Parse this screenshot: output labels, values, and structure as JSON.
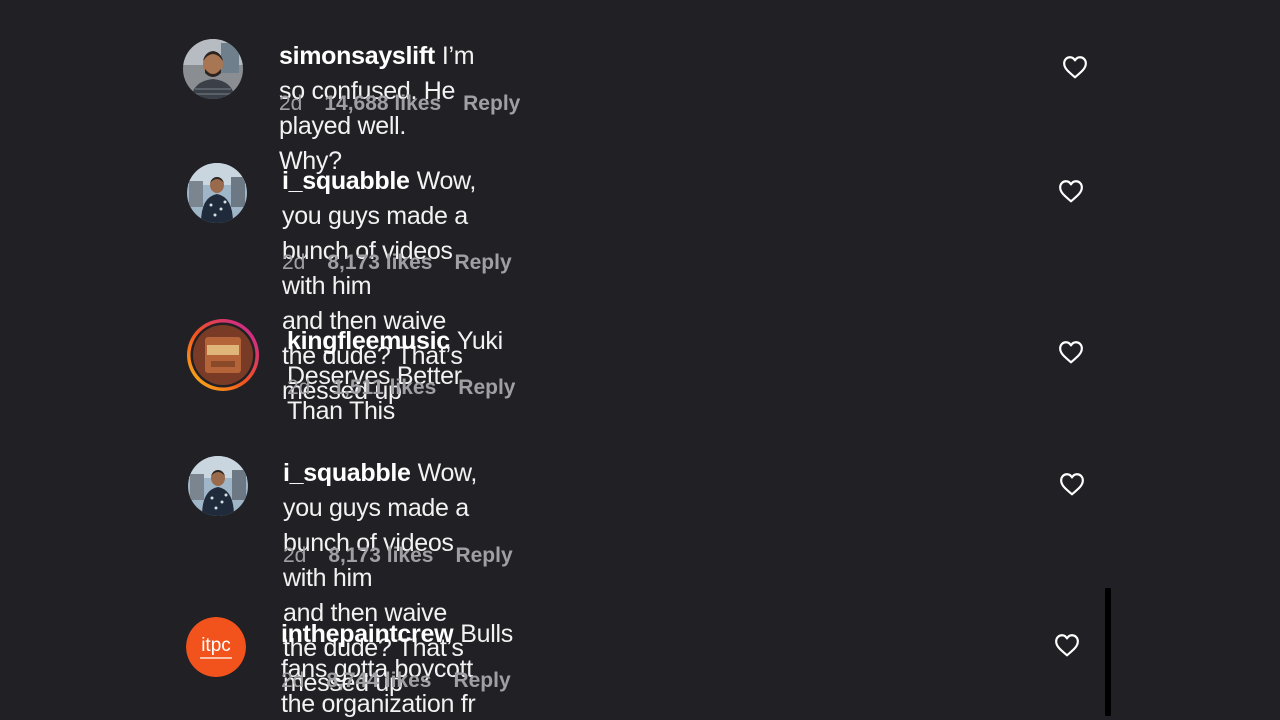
{
  "comments": [
    {
      "username": "simonsayslift",
      "text": "I’m so confused. He played well. Why?",
      "age": "2d",
      "likes": "14,688 likes",
      "reply": "Reply",
      "avatar_icon": "person-photo-avatar"
    },
    {
      "username": "i_squabble",
      "text": "Wow, you guys made a bunch of videos with him\nand then waive the dude? That’s messed up",
      "age": "2d",
      "likes": "8,173 likes",
      "reply": "Reply",
      "avatar_icon": "person-photo-avatar"
    },
    {
      "username": "kingfleemusic",
      "text": "Yuki Deserves Better Than This",
      "age": "2d",
      "likes": "1,511 likes",
      "reply": "Reply",
      "avatar_icon": "story-ring-avatar"
    },
    {
      "username": "i_squabble",
      "text": "Wow, you guys made a bunch of videos with him\nand then waive the dude? That’s messed up",
      "age": "2d",
      "likes": "8,173 likes",
      "reply": "Reply",
      "avatar_icon": "person-photo-avatar"
    },
    {
      "username": "inthepaintcrew",
      "text": "Bulls fans gotta boycott the organization fr",
      "age": "2d",
      "likes": "8,744 likes",
      "reply": "Reply",
      "avatar_icon": "itpc-logo-avatar",
      "avatar_logo_text": "itpc"
    }
  ],
  "icons": {
    "like": "heart-icon"
  },
  "colors": {
    "background": "#212125",
    "text": "#f2f2f2",
    "meta": "#a0a0a4",
    "itpc_orange": "#f2521b"
  }
}
